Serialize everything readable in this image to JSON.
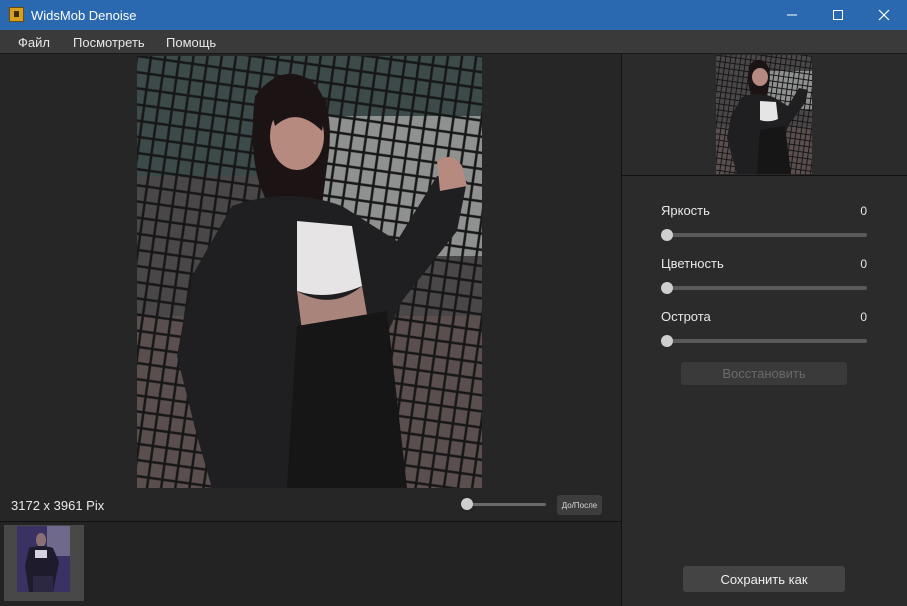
{
  "window": {
    "title": "WidsMob Denoise",
    "controls": [
      "minimize-icon",
      "maximize-icon",
      "close-icon"
    ]
  },
  "menu": {
    "items": [
      "Файл",
      "Посмотреть",
      "Помощь"
    ]
  },
  "viewer": {
    "dimensions_text": "3172 x 3961 Pix",
    "zoom_slider_value": 0,
    "before_after_label": "До/После"
  },
  "adjustments": [
    {
      "label": "Яркость",
      "value": "0"
    },
    {
      "label": "Цветность",
      "value": "0"
    },
    {
      "label": "Острота",
      "value": "0"
    }
  ],
  "buttons": {
    "restore_label": "Восстановить",
    "save_label": "Сохранить как"
  },
  "colors": {
    "titlebar": "#2a69b0",
    "background": "#2b2b2b",
    "filmstrip_selected": "#484848"
  }
}
